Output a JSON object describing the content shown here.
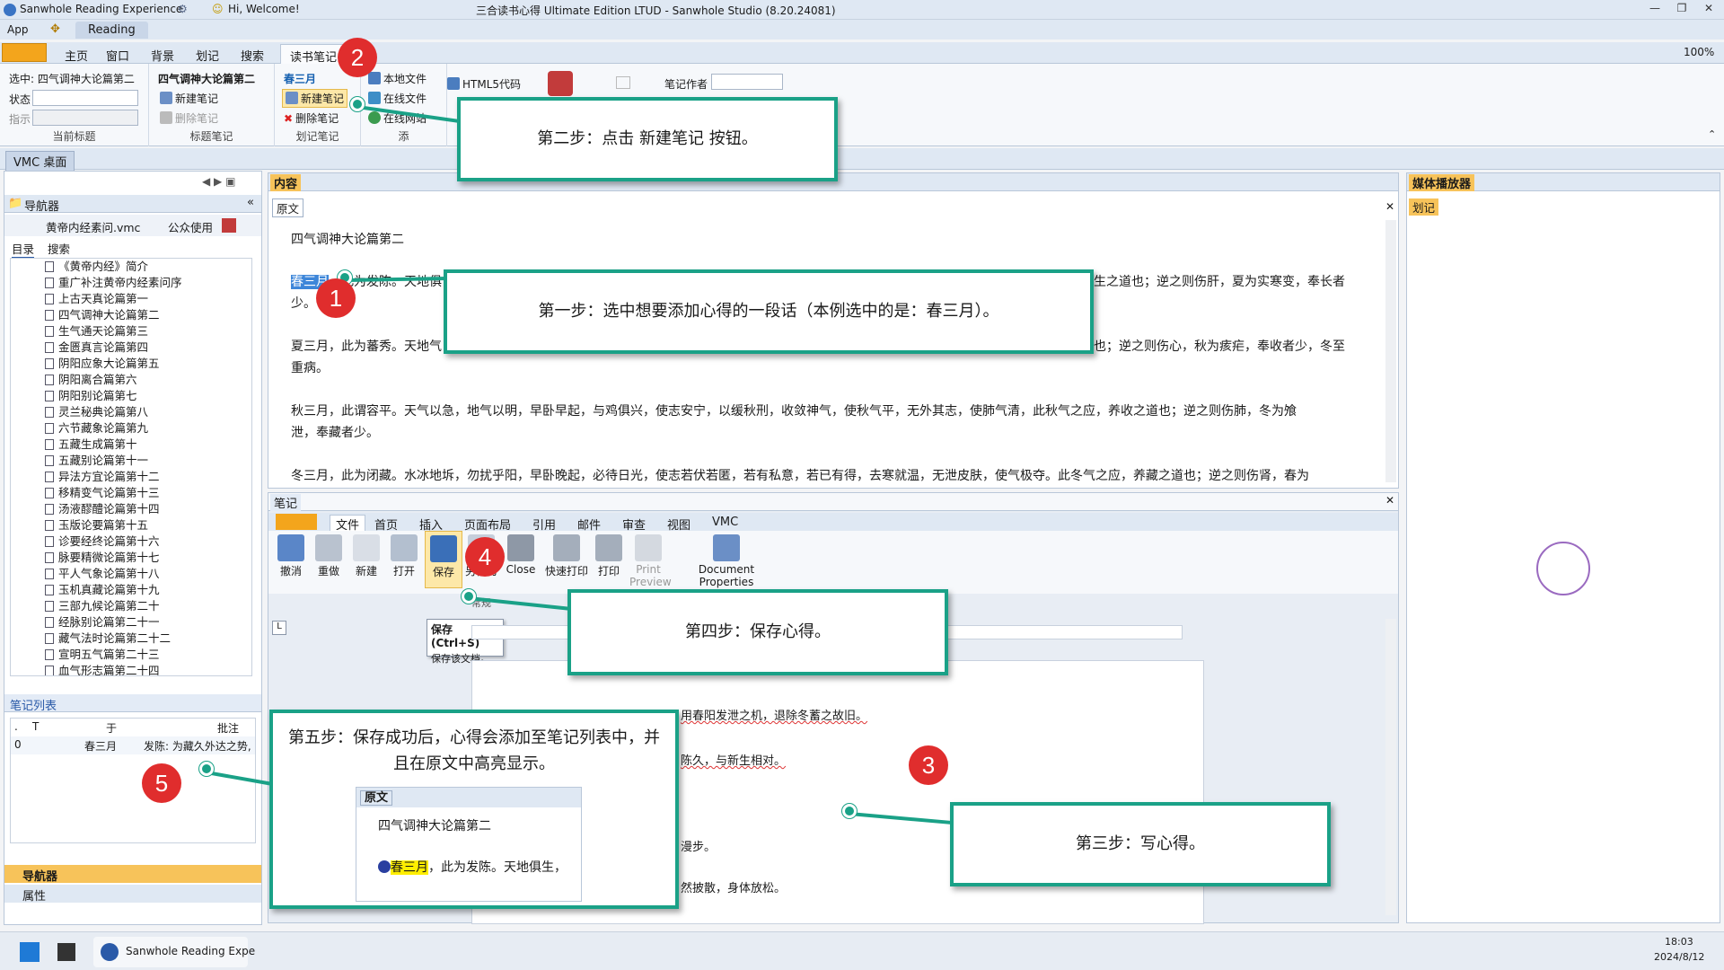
{
  "window": {
    "app_name": "Sanwhole Reading Experience",
    "greeting": "Hi, Welcome!",
    "title": "三合读书心得 Ultimate Edition LTUD - Sanwhole Studio (8.20.24081)"
  },
  "menu": {
    "app": "App",
    "reading_tab": "Reading"
  },
  "ribbon_tabs": [
    "主页",
    "窗口",
    "背景",
    "划记",
    "搜索",
    "读书笔记"
  ],
  "zoom": "100%",
  "ribbon": {
    "selected_label": "选中: 四气调神大论篇第二",
    "status_label": "状态",
    "indicator_label": "指示",
    "group_current_title": "当前标题",
    "title_text": "四气调神大论篇第二",
    "new_note": "新建笔记",
    "delete_note": "删除笔记",
    "group_title_notes": "标题笔记",
    "mark_text": "春三月",
    "new_note2": "新建笔记",
    "delete_note2": "删除笔记",
    "group_mark_notes": "划记笔记",
    "local_file": "本地文件",
    "online_file": "在线文件",
    "online_link": "在线网站",
    "group_add": "添",
    "html5_code": "HTML5代码",
    "note_author_label": "笔记作者"
  },
  "vmc_tab": "VMC 桌面",
  "navigator": {
    "title": "导航器",
    "file": "黄帝内经素问.vmc",
    "usage": "公众使用",
    "tabs": [
      "目录",
      "搜索"
    ],
    "items": [
      "《黄帝内经》简介",
      "重广补注黄帝内经素问序",
      "上古天真论篇第一",
      "四气调神大论篇第二",
      "生气通天论篇第三",
      "金匮真言论篇第四",
      "阴阳应象大论篇第五",
      "阴阳离合篇第六",
      "阴阳别论篇第七",
      "灵兰秘典论篇第八",
      "六节藏象论篇第九",
      "五藏生成篇第十",
      "五藏别论篇第十一",
      "异法方宜论篇第十二",
      "移精变气论篇第十三",
      "汤液醪醴论篇第十四",
      "玉版论要篇第十五",
      "诊要经终论篇第十六",
      "脉要精微论篇第十七",
      "平人气象论篇第十八",
      "玉机真藏论篇第十九",
      "三部九候论篇第二十",
      "经脉别论篇第二十一",
      "藏气法时论篇第二十二",
      "宣明五气篇第二十三",
      "血气形志篇第二十四"
    ]
  },
  "notes_list": {
    "title": "笔记列表",
    "columns": [
      ".",
      "T",
      "于",
      "批注"
    ],
    "row": {
      "idx": "0",
      "mark": "春三月",
      "comment": "发陈: 为藏久外达之势,"
    }
  },
  "bottom_panels": [
    "导航器",
    "属性"
  ],
  "content": {
    "header": "内容",
    "tab": "原文",
    "title": "四气调神大论篇第二",
    "para1_sel": "春三月",
    "para1_a": "，此为发陈。天地俱",
    "para1_b": "生之道也；逆之则伤肝，夏为实寒变，奉长者",
    "para1_c": "少。",
    "para2_a": "夏三月，此为蕃秀。天地气",
    "para2_b": "也；逆之则伤心，秋为痎疟，奉收者少，冬至",
    "para2_c": "重病。",
    "para3_a": "秋三月，此谓容平。天气以急，地气以明，早卧早起，与鸡俱兴，使志安宁，以缓秋刑，收敛神气，使秋气平，无外其志，使肺气清，此秋气之应，养收之道也；逆之则伤肺，冬为飧",
    "para3_b": "泄，奉藏者少。",
    "para4_a": "冬三月，此为闭藏。水冰地坼，勿扰乎阳，早卧晚起，必待日光，使志若伏若匿，若有私意，若已有得，去寒就温，无泄皮肤，使气极夺。此冬气之应，养藏之道也；逆之则伤肾，春为"
  },
  "notes_panel": {
    "header": "笔记",
    "tabs": [
      "文件",
      "首页",
      "插入",
      "页面布局",
      "引用",
      "邮件",
      "审查",
      "视图",
      "VMC"
    ],
    "buttons": [
      "撤消",
      "重做",
      "新建",
      "打开",
      "保存",
      "另存为",
      "Close",
      "快速打印",
      "打印",
      "Print Preview",
      "Document Properties"
    ],
    "group_common": "常规",
    "tooltip_title": "保存 (Ctrl+S)",
    "tooltip_desc": "保存该文档。",
    "doc_line1": "用春阳发泄之机，退除冬蓄之故旧。",
    "doc_line2": "陈久，与新生相对。",
    "doc_line3": "漫步。",
    "doc_line4": "然披散，身体放松。"
  },
  "media_player": {
    "header": "媒体播放器",
    "tab": "划记"
  },
  "callouts": {
    "step1": "第一步：选中想要添加心得的一段话（本例选中的是：春三月）。",
    "step2": "第二步：点击 新建笔记 按钮。",
    "step3": "第三步：写心得。",
    "step4": "第四步：保存心得。",
    "step5_a": "第五步：保存成功后，心得会添加至笔记列表中，并",
    "step5_b": "且在原文中高亮显示。",
    "step5_tab": "原文",
    "step5_title": "四气调神大论篇第二",
    "step5_mark": "春三月",
    "step5_text": "，此为发陈。天地俱生，"
  },
  "badges": [
    "1",
    "2",
    "3",
    "4",
    "5"
  ],
  "taskbar": {
    "app": "Sanwhole Reading Expe",
    "time": "18:03",
    "date": "2024/8/12"
  },
  "colors": {
    "accent": "#1aa187",
    "badge": "#e02d2d",
    "highlight": "#ffee00",
    "selection": "#3d86d9"
  }
}
